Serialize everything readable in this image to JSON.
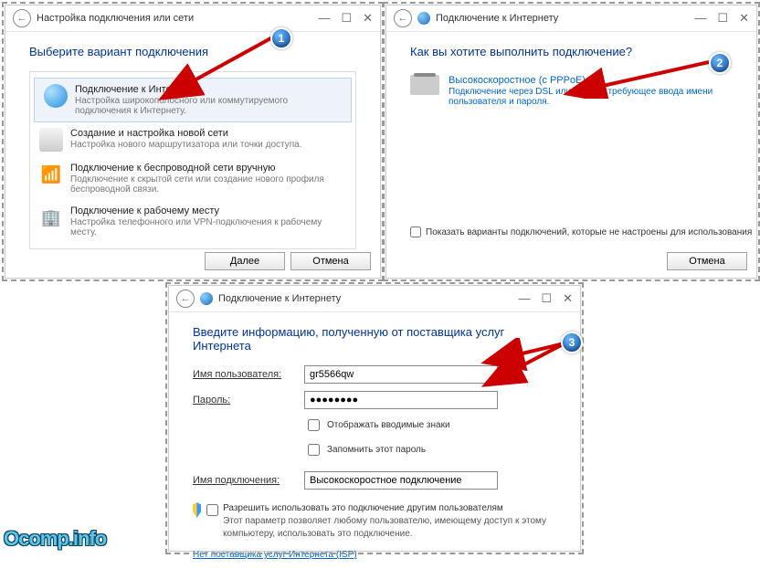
{
  "dlg1": {
    "title": "Настройка подключения или сети",
    "heading": "Выберите вариант подключения",
    "opts": [
      {
        "t": "Подключение к Интернету",
        "d": "Настройка широкополосного или коммутируемого подключения к Интернету."
      },
      {
        "t": "Создание и настройка новой сети",
        "d": "Настройка нового маршрутизатора или точки доступа."
      },
      {
        "t": "Подключение к беспроводной сети вручную",
        "d": "Подключение к скрытой сети или создание нового профиля беспроводной связи."
      },
      {
        "t": "Подключение к рабочему месту",
        "d": "Настройка телефонного или VPN-подключения к рабочему месту."
      }
    ],
    "next": "Далее",
    "cancel": "Отмена"
  },
  "dlg2": {
    "title": "Подключение к Интернету",
    "heading": "Как вы хотите выполнить подключение?",
    "pppoe_t": "Высокоскоростное (с PPPoE)",
    "pppoe_d": "Подключение через DSL или кабель, требующее ввода имени пользователя и пароля.",
    "showopts": "Показать варианты подключений, которые не настроены для использования",
    "cancel": "Отмена"
  },
  "dlg3": {
    "title": "Подключение к Интернету",
    "heading": "Введите информацию, полученную от поставщика услуг Интернета",
    "user_l": "Имя пользователя:",
    "user_v": "gr5566qw",
    "pass_l": "Пароль:",
    "pass_v": "●●●●●●●●",
    "showchars": "Отображать вводимые знаки",
    "remember": "Запомнить этот пароль",
    "conn_l": "Имя подключения:",
    "conn_v": "Высокоскоростное подключение",
    "permit": "Разрешить использовать это подключение другим пользователям",
    "permit_d": "Этот параметр позволяет любому пользователю, имеющему доступ к этому компьютеру, использовать это подключение.",
    "noisp": "Нет поставщика услуг Интернета (ISP)"
  },
  "badges": {
    "b1": "1",
    "b2": "2",
    "b3": "3"
  },
  "logo": "Ocomp.info"
}
